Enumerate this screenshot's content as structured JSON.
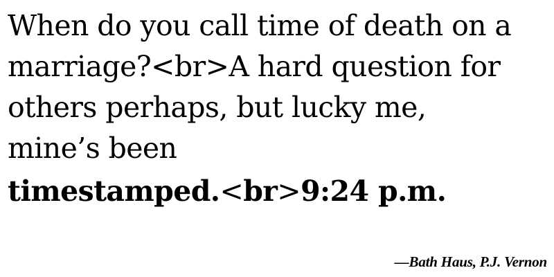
{
  "quote": {
    "line1": "When do you call time of death on a",
    "line2": "marriage?<br>A hard question for",
    "line3": "others perhaps, but lucky me,",
    "line4": "mine’s been",
    "line5_part1": "timestamped.",
    "line5_tag_open": "<",
    "line5_tag_word": "br",
    "line5_tag_close": ">",
    "line5_part2": "9:24 p.m."
  },
  "attribution": {
    "text": "—Bath Haus, P.J. Vernon"
  }
}
